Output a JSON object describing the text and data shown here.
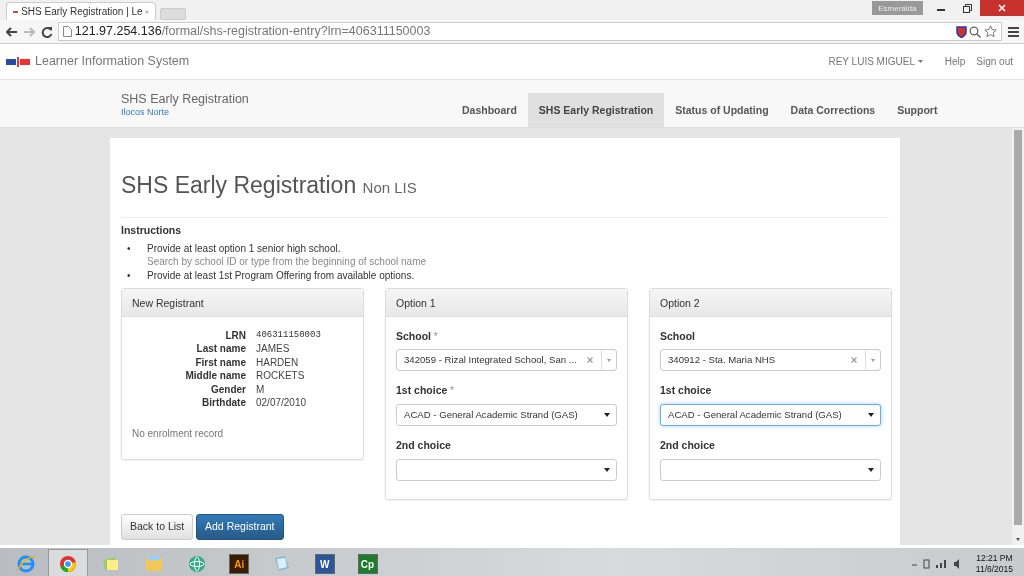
{
  "browser": {
    "tab_title": "SHS Early Registration | Le",
    "profile": "Esmeralda",
    "address_host": "121.97.254.136",
    "address_path": "/formal/shs-registration-entry?lrn=406311150003"
  },
  "navbar": {
    "brand": "Learner Information System",
    "user": "REY LUIS MIGUEL",
    "links": [
      "Help",
      "Sign out"
    ]
  },
  "subnav": {
    "title": "SHS Early Registration",
    "subtitle": "Ilocos Norte",
    "tabs": [
      {
        "label": "Dashboard",
        "selected": false
      },
      {
        "label": "SHS Early Registration",
        "selected": true
      },
      {
        "label": "Status of Updating",
        "selected": false
      },
      {
        "label": "Data Corrections",
        "selected": false
      },
      {
        "label": "Support",
        "selected": false
      }
    ]
  },
  "page": {
    "heading": "SHS Early Registration",
    "heading_small": "Non LIS",
    "instructions_title": "Instructions",
    "instructions": [
      {
        "marker": "•",
        "text": "Provide at least option 1 senior high school.",
        "hint": "Search by school ID or type from the beginning of school name"
      },
      {
        "marker": "•",
        "text": "Provide at least 1st Program Offering from available options."
      }
    ]
  },
  "registrant": {
    "title": "New Registrant",
    "fields": [
      {
        "label": "LRN",
        "value": "406311150003",
        "kind": "mono"
      },
      {
        "label": "Last name",
        "value": "JAMES",
        "kind": "text"
      },
      {
        "label": "First name",
        "value": "HARDEN",
        "kind": "text"
      },
      {
        "label": "Middle name",
        "value": "ROCKETS",
        "kind": "text"
      },
      {
        "label": "Gender",
        "value": "M",
        "kind": "text"
      },
      {
        "label": "Birthdate",
        "value": "02/07/2010",
        "kind": "text"
      }
    ],
    "note": "No enrolment record"
  },
  "options": [
    {
      "title": "Option 1",
      "fields": [
        {
          "label": "School",
          "required_mark": "*",
          "kind": "combo",
          "value": "342059 - Rizal Integrated School, San ...",
          "focused": false
        },
        {
          "label": "1st choice",
          "required_mark": "*",
          "kind": "select",
          "value": "ACAD - General Academic Strand (GAS)",
          "focused": false
        },
        {
          "label": "2nd choice",
          "kind": "select",
          "focused": false
        }
      ]
    },
    {
      "title": "Option 2",
      "fields": [
        {
          "label": "School",
          "kind": "combo",
          "value": "340912 - Sta. Maria NHS",
          "focused": false
        },
        {
          "label": "1st choice",
          "kind": "select",
          "value": "ACAD - General Academic Strand (GAS)",
          "focused": true
        },
        {
          "label": "2nd choice",
          "kind": "select",
          "focused": false
        }
      ]
    }
  ],
  "buttons": [
    {
      "label": "Back to List",
      "kind": "default"
    },
    {
      "label": "Add Registrant",
      "kind": "primary"
    }
  ],
  "taskbar": {
    "apps": [
      {
        "kind": "ie",
        "selected": false
      },
      {
        "kind": "chrome",
        "selected": true
      },
      {
        "kind": "notes",
        "selected": false
      },
      {
        "kind": "folder",
        "selected": false
      },
      {
        "kind": "atom",
        "selected": false
      },
      {
        "kind": "ai",
        "label": "Ai",
        "selected": false
      },
      {
        "kind": "book",
        "selected": false
      },
      {
        "kind": "word",
        "label": "W",
        "selected": false
      },
      {
        "kind": "cp",
        "label": "Cp",
        "selected": false
      }
    ],
    "time": "12:21 PM",
    "date": "11/6/2015"
  }
}
